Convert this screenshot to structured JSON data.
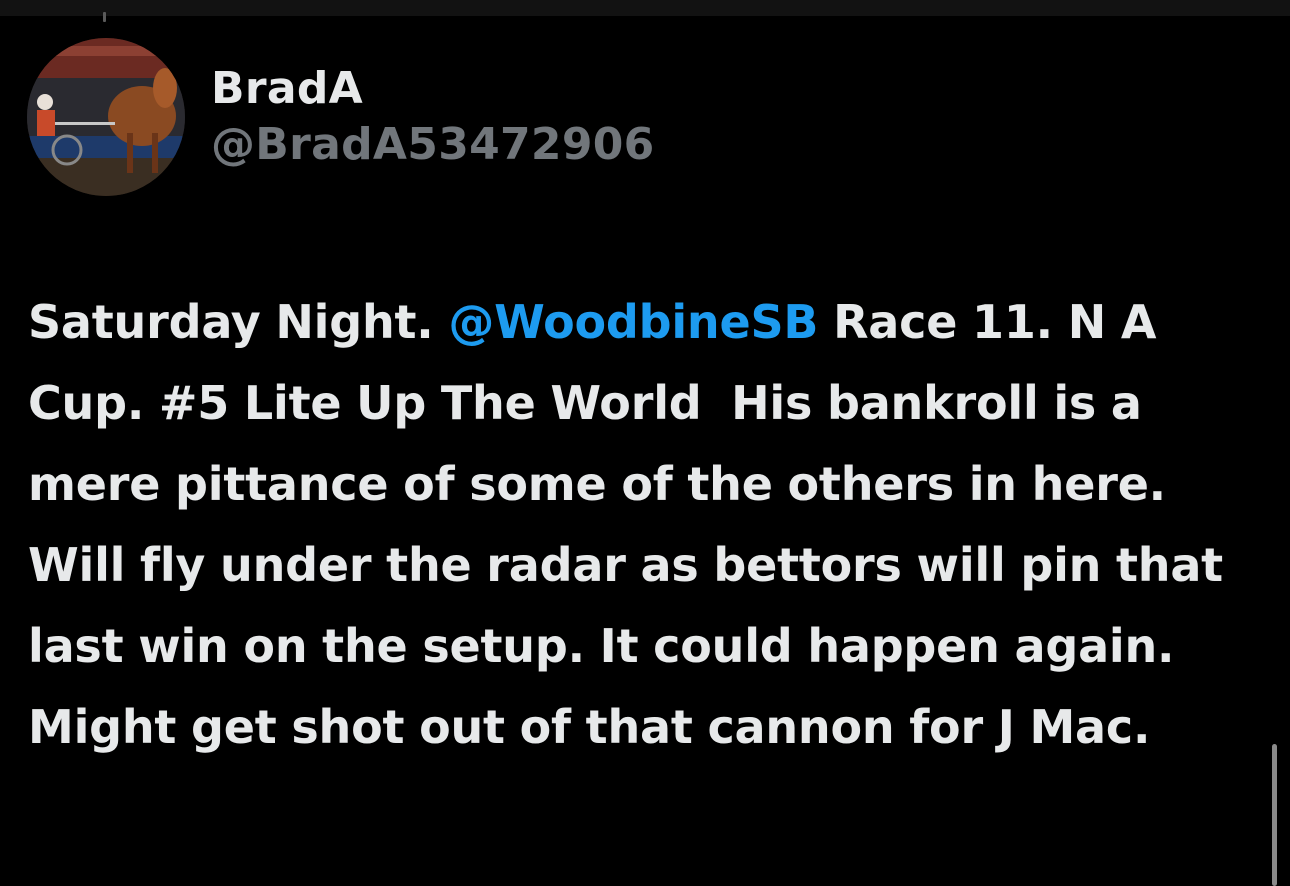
{
  "user": {
    "display_name": "BradA",
    "handle": "@BradA53472906",
    "avatar_icon": "harness-racing-photo-avatar"
  },
  "tweet": {
    "text_before_mention": "Saturday Night. ",
    "mention": "@WoodbineSB",
    "text_after_mention": " Race 11. N A Cup. #5 Lite Up The World  His bankroll is a mere pittance of some of the others in here. Will fly under the radar as bettors will pin that last win on the setup. It could happen again. Might get shot out of that cannon for J Mac."
  },
  "colors": {
    "background": "#000000",
    "text": "#e7e9ea",
    "secondary_text": "#71767b",
    "mention_link": "#1d9bf0"
  }
}
